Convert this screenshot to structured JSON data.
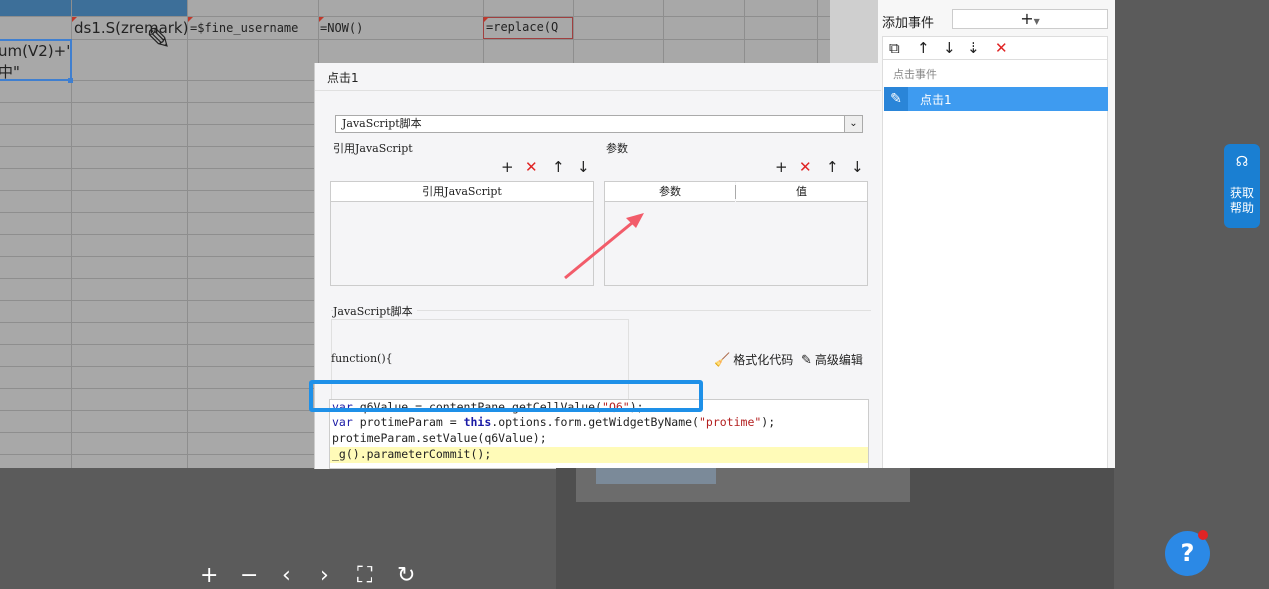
{
  "sheet": {
    "cells": {
      "a_row2_line1": "um(V2)+\"",
      "a_row2_line2": "中\"",
      "b_row1": "ds1.S(zremark)",
      "c_row1": "=$fine_username",
      "d_row1": "=NOW()",
      "f_row1": "=replace(Q"
    }
  },
  "event_panel": {
    "title": "添加事件",
    "add_label": "+",
    "list_header": "点击事件",
    "items": [
      {
        "label": "点击1"
      }
    ]
  },
  "dialog": {
    "title": "点击1",
    "type_select": "JavaScript脚本",
    "ref_js_section": "引用JavaScript",
    "params_section": "参数",
    "ref_js_column": "引用JavaScript",
    "param_column": "参数",
    "value_column": "值",
    "js_section": "JavaScript脚本",
    "function_text": "function(){",
    "format_code": "格式化代码",
    "advanced_edit": "高级编辑",
    "code_lines": [
      "var q6Value = contentPane.getCellValue(\"Q6\");",
      "var protimeParam = this.options.form.getWidgetByName(\"protime\");",
      "protimeParam.setValue(q6Value);",
      "_g().parameterCommit();"
    ]
  },
  "help": {
    "side_text": "获取帮助",
    "fab_label": "?"
  },
  "colors": {
    "accent": "#3e9bf0",
    "highlight_box": "#1e90e8",
    "delete_red": "#e02424"
  }
}
